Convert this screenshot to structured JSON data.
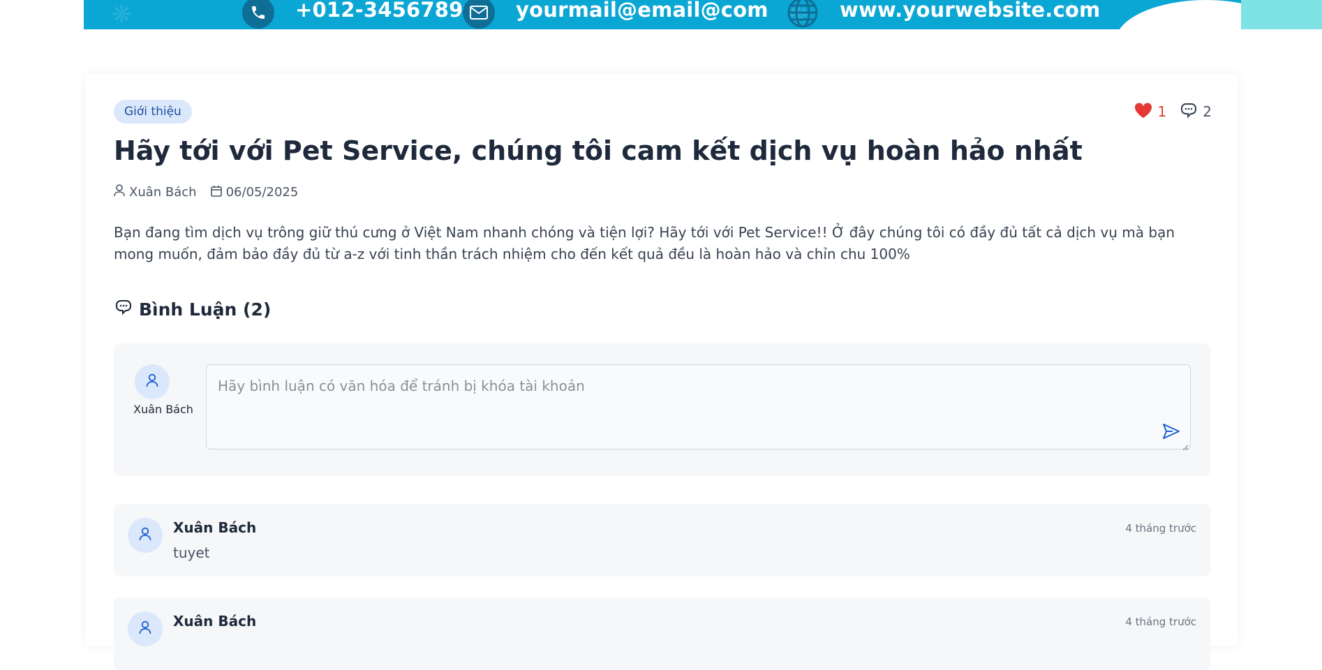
{
  "topbar": {
    "phone": "+012-3456789",
    "email": "yourmail@email@com",
    "website": "www.yourwebsite.com",
    "phone_icon": "phone-icon",
    "email_icon": "envelope-icon",
    "website_icon": "globe-icon"
  },
  "article": {
    "category": "Giới thiệu",
    "likes": "1",
    "comments_count": "2",
    "title": "Hãy tới với Pet Service, chúng tôi cam kết dịch vụ hoàn hảo nhất",
    "author": "Xuân Bách",
    "date": "06/05/2025",
    "body": "Bạn đang tìm dịch vụ trông giữ thú cưng ở Việt Nam nhanh chóng và tiện lợi? Hãy tới với Pet Service!! Ở đây chúng tôi có đầy đủ tất cả dịch vụ mà bạn mong muốn, đảm bảo đầy đủ từ a-z với tinh thần trách nhiệm cho đến kết quả đều là hoàn hảo và chỉn chu 100%"
  },
  "comments_section": {
    "heading": "Bình Luận (2)",
    "compose": {
      "user_name": "Xuân Bách",
      "placeholder": "Hãy bình luận có văn hóa để tránh bị khóa tài khoản"
    },
    "items": [
      {
        "name": "Xuân Bách",
        "text": "tuyet",
        "time": "4 tháng trước"
      },
      {
        "name": "Xuân Bách",
        "text": "",
        "time": "4 tháng trước"
      }
    ]
  },
  "colors": {
    "banner": "#0aa6d4",
    "accent": "#1e5fd0",
    "like": "#e53935"
  }
}
